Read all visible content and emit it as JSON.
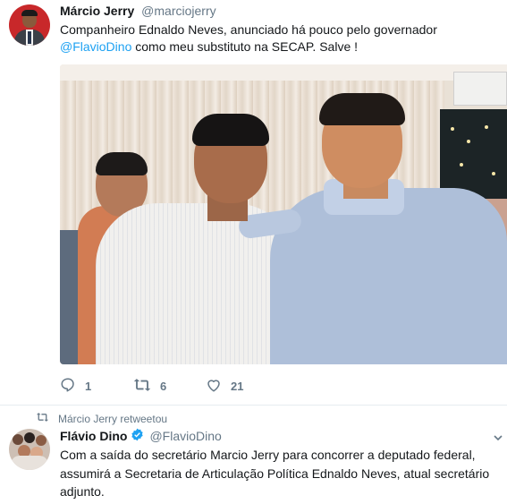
{
  "tweet1": {
    "author_name": "Márcio Jerry",
    "author_handle": "@marciojerry",
    "text_before_mention": "Companheiro Ednaldo Neves, anunciado há pouco pelo governador ",
    "mention": "@FlavioDino",
    "text_after_mention": " como meu substituto na SECAP. Salve !",
    "reply_count": "1",
    "retweet_count": "6",
    "like_count": "21"
  },
  "retweet_context": {
    "label": "Márcio Jerry retweetou"
  },
  "tweet2": {
    "author_name": "Flávio Dino",
    "author_handle": "@FlavioDino",
    "text": "Com a saída do secretário Marcio Jerry para concorrer a deputado federal, assumirá a Secretaria de Articulação Política Ednaldo Neves, atual secretário adjunto."
  },
  "icons": {
    "reply": "reply-icon",
    "retweet": "retweet-icon",
    "like": "heart-icon",
    "verified": "verified-badge-icon",
    "more": "chevron-down-icon"
  },
  "colors": {
    "link": "#1da1f2",
    "secondary_text": "#657786",
    "verified": "#1da1f2",
    "divider": "#e6ecf0"
  }
}
